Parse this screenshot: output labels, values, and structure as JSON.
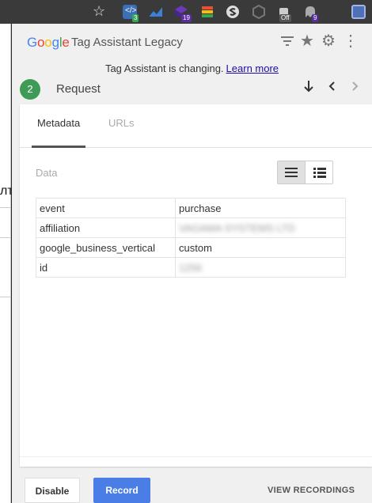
{
  "browser": {
    "bookmark_icon": "star-icon",
    "extensions": [
      {
        "name": "tag-assistant-ext-icon",
        "badge": "3",
        "color": "#3b6fb6",
        "badge_color": "#34a853"
      },
      {
        "name": "wave-ext-icon",
        "badge": "",
        "color": "#3b7fd9"
      },
      {
        "name": "cube-ext-icon",
        "badge": "19",
        "color": "#6a3ab8",
        "badge_color": "#5a2da0"
      },
      {
        "name": "stack-ext-icon",
        "badge": "",
        "color": "#e94e3b"
      },
      {
        "name": "s-circle-ext-icon",
        "badge": "",
        "color": "#dddddd"
      },
      {
        "name": "hex-ext-icon",
        "badge": "",
        "color": "#777777"
      },
      {
        "name": "cup-ext-icon",
        "badge": "Off",
        "color": "#cccccc",
        "badge_color": "#555555"
      },
      {
        "name": "ghost-ext-icon",
        "badge": "9",
        "color": "#aaaaaa",
        "badge_color": "#5a2da0"
      }
    ]
  },
  "background_page": {
    "cut_text": "лт"
  },
  "header": {
    "logo_letters": [
      "G",
      "o",
      "o",
      "g",
      "l",
      "e"
    ],
    "title": "Tag Assistant Legacy",
    "icons": [
      "filter-icon",
      "star-icon",
      "gear-icon",
      "more-vert-icon"
    ]
  },
  "notice": {
    "text": "Tag Assistant is changing.",
    "link": "Learn more"
  },
  "request": {
    "number": "2",
    "label": "Request",
    "nav": {
      "down": "↓",
      "prev": "‹",
      "next": "›"
    }
  },
  "tabs": [
    {
      "label": "Metadata",
      "active": true
    },
    {
      "label": "URLs",
      "active": false
    }
  ],
  "data_section": {
    "label": "Data",
    "view_modes": [
      "list-view-icon",
      "detail-view-icon"
    ]
  },
  "metadata_rows": [
    {
      "key": "event",
      "value": "purchase",
      "blurred": false
    },
    {
      "key": "affiliation",
      "value": "VAGAMA SYSTEMS LTD",
      "blurred": true
    },
    {
      "key": "google_business_vertical",
      "value": "custom",
      "blurred": false
    },
    {
      "key": "id",
      "value": "1256",
      "blurred": true
    }
  ],
  "footer": {
    "disable": "Disable",
    "record": "Record",
    "view_recordings": "VIEW RECORDINGS"
  },
  "colors": {
    "accent_green": "#3e9b56",
    "record_blue": "#4a7ee6",
    "link": "#1a0dab"
  }
}
